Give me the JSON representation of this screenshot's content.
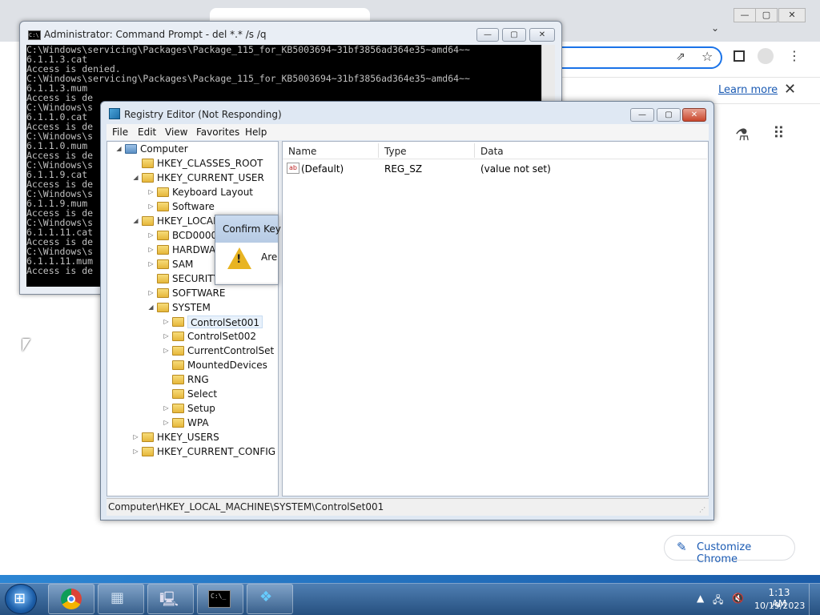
{
  "chrome": {
    "learn_more": "Learn more",
    "close_glyph": "✕",
    "customize_label": "Customize Chrome",
    "customize_icon": "pencil-icon"
  },
  "cmd": {
    "title": "Administrator: Command Prompt - del  *.* /s /q",
    "lines": [
      "C:\\Windows\\servicing\\Packages\\Package_115_for_KB5003694~31bf3856ad364e35~amd64~~",
      "6.1.1.3.cat",
      "Access is denied.",
      "C:\\Windows\\servicing\\Packages\\Package_115_for_KB5003694~31bf3856ad364e35~amd64~~",
      "6.1.1.3.mum",
      "Access is de",
      "C:\\Windows\\s",
      "6.1.1.0.cat",
      "Access is de",
      "C:\\Windows\\s",
      "6.1.1.0.mum",
      "Access is de",
      "C:\\Windows\\s",
      "6.1.1.9.cat",
      "Access is de",
      "C:\\Windows\\s",
      "6.1.1.9.mum",
      "Access is de",
      "C:\\Windows\\s",
      "6.1.1.11.cat",
      "Access is de",
      "C:\\Windows\\s",
      "6.1.1.11.mum",
      "Access is de"
    ]
  },
  "regedit": {
    "title": "Registry Editor (Not Responding)",
    "menu": [
      "File",
      "Edit",
      "View",
      "Favorites",
      "Help"
    ],
    "tree": [
      {
        "label": "Computer",
        "level": 0,
        "exp": "◢"
      },
      {
        "label": "HKEY_CLASSES_ROOT",
        "level": 1,
        "exp": ""
      },
      {
        "label": "HKEY_CURRENT_USER",
        "level": 1,
        "exp": "◢"
      },
      {
        "label": "Keyboard Layout",
        "level": 2,
        "exp": "▷"
      },
      {
        "label": "Software",
        "level": 2,
        "exp": "▷"
      },
      {
        "label": "HKEY_LOCAL",
        "level": 1,
        "exp": "◢"
      },
      {
        "label": "BCD00000",
        "level": 2,
        "exp": "▷"
      },
      {
        "label": "HARDWA",
        "level": 2,
        "exp": "▷"
      },
      {
        "label": "SAM",
        "level": 2,
        "exp": "▷"
      },
      {
        "label": "SECURITY",
        "level": 2,
        "exp": ""
      },
      {
        "label": "SOFTWARE",
        "level": 2,
        "exp": "▷"
      },
      {
        "label": "SYSTEM",
        "level": 2,
        "exp": "◢"
      },
      {
        "label": "ControlSet001",
        "level": 3,
        "exp": "▷"
      },
      {
        "label": "ControlSet002",
        "level": 3,
        "exp": "▷"
      },
      {
        "label": "CurrentControlSet",
        "level": 3,
        "exp": "▷"
      },
      {
        "label": "MountedDevices",
        "level": 3,
        "exp": ""
      },
      {
        "label": "RNG",
        "level": 3,
        "exp": ""
      },
      {
        "label": "Select",
        "level": 3,
        "exp": ""
      },
      {
        "label": "Setup",
        "level": 3,
        "exp": "▷"
      },
      {
        "label": "WPA",
        "level": 3,
        "exp": "▷"
      },
      {
        "label": "HKEY_USERS",
        "level": 1,
        "exp": "▷"
      },
      {
        "label": "HKEY_CURRENT_CONFIG",
        "level": 1,
        "exp": "▷"
      }
    ],
    "selected": "ControlSet001",
    "columns": [
      "Name",
      "Type",
      "Data"
    ],
    "rows": [
      {
        "name": "(Default)",
        "type": "REG_SZ",
        "data": "(value not set)",
        "icon": "ab"
      }
    ],
    "status": "Computer\\HKEY_LOCAL_MACHINE\\SYSTEM\\ControlSet001"
  },
  "confirm": {
    "title": "Confirm Key",
    "text": "Are",
    "icon": "warning-icon"
  },
  "taskbar": {
    "time": "1:13 AM",
    "date": "10/19/2023"
  }
}
